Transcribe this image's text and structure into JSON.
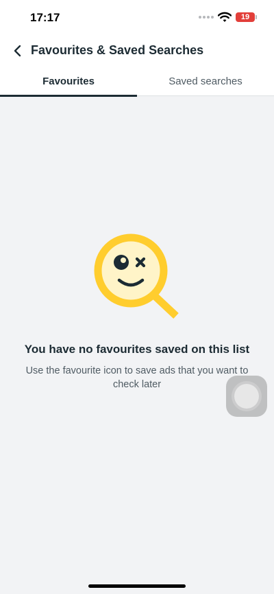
{
  "status_bar": {
    "time": "17:17",
    "battery_level": "19"
  },
  "header": {
    "back_icon": "chevron-left-icon",
    "title": "Favourites & Saved Searches"
  },
  "tabs": [
    {
      "label": "Favourites",
      "active": true
    },
    {
      "label": "Saved searches",
      "active": false
    }
  ],
  "empty_state": {
    "illustration": "magnifier-smiley-icon",
    "title": "You have no favourites saved on this list",
    "subtitle": "Use the favourite icon to save ads that you want to check later"
  },
  "colors": {
    "accent": "#ffcd2e",
    "text": "#1c2b33",
    "background": "#f2f3f5",
    "battery": "#e23f3a"
  }
}
